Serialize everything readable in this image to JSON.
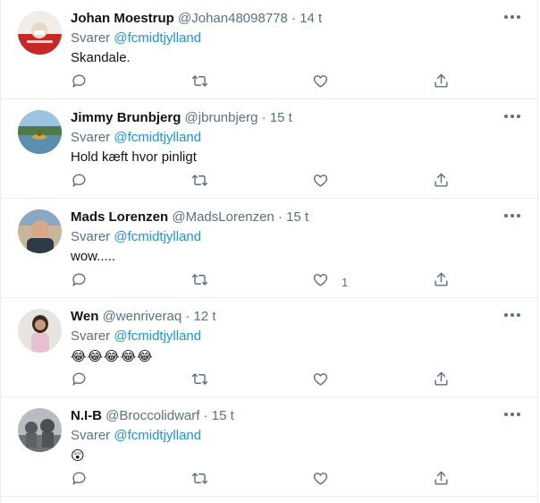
{
  "tweets": [
    {
      "name": "Johan Moestrup",
      "handle": "@Johan48098778",
      "time": "14 t",
      "reply_prefix": "Svarer",
      "reply_to": "@fcmidtjylland",
      "text": "Skandale.",
      "like_count": ""
    },
    {
      "name": "Jimmy Brunbjerg",
      "handle": "@jbrunbjerg",
      "time": "15 t",
      "reply_prefix": "Svarer",
      "reply_to": "@fcmidtjylland",
      "text": "Hold kæft hvor pinligt",
      "like_count": ""
    },
    {
      "name": "Mads Lorenzen",
      "handle": "@MadsLorenzen",
      "time": "15 t",
      "reply_prefix": "Svarer",
      "reply_to": "@fcmidtjylland",
      "text": "wow.....",
      "like_count": "1"
    },
    {
      "name": "Wen",
      "handle": "@wenriveraq",
      "time": "12 t",
      "reply_prefix": "Svarer",
      "reply_to": "@fcmidtjylland",
      "text": "😂😂😂😂😂",
      "like_count": ""
    },
    {
      "name": "N.I-B",
      "handle": "@Broccolidwarf",
      "time": "15 t",
      "reply_prefix": "Svarer",
      "reply_to": "@fcmidtjylland",
      "text": "😲",
      "like_count": ""
    }
  ],
  "separator": "·",
  "icons": {
    "reply": "reply-icon",
    "retweet": "retweet-icon",
    "like": "heart-icon",
    "share": "share-icon",
    "more": "more-icon"
  },
  "colors": {
    "link": "#1b95e0",
    "secondary": "#5b7083",
    "text": "#0f1419",
    "divider": "#ebeef0"
  }
}
